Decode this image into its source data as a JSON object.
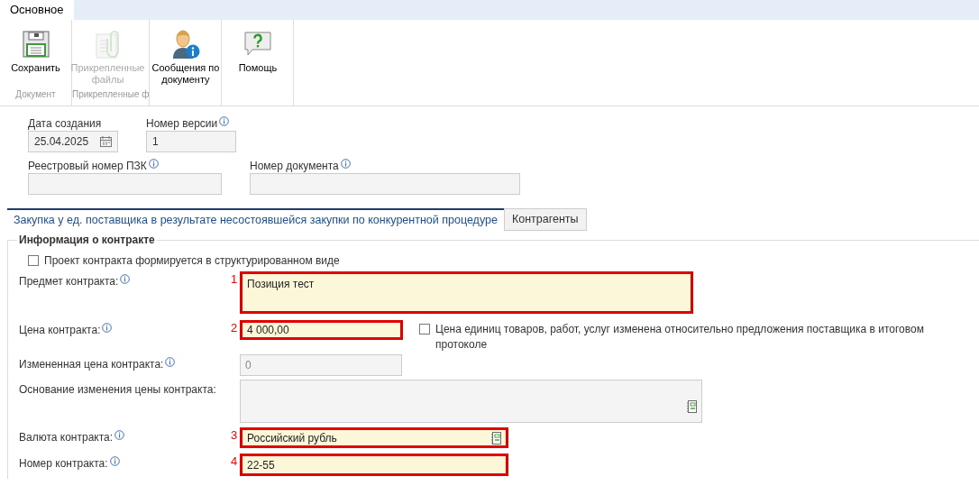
{
  "ribbon": {
    "tabs": [
      {
        "label": "Основное",
        "selected": true
      }
    ],
    "groups": [
      {
        "caption": "Документ",
        "buttons": [
          {
            "label": "Сохранить",
            "disabled": false
          }
        ]
      },
      {
        "caption": "Прикрепленные ф",
        "buttons": [
          {
            "label": "Прикрепленные файлы",
            "disabled": true
          }
        ]
      },
      {
        "buttons": [
          {
            "label": "Сообщения по документу",
            "disabled": false
          }
        ]
      },
      {
        "buttons": [
          {
            "label": "Помощь",
            "disabled": false
          }
        ]
      }
    ]
  },
  "header_fields": [
    [
      {
        "label": "Дата создания",
        "value": "25.04.2025",
        "info": false,
        "kind": "date"
      },
      {
        "label": "Номер версии",
        "value": "1",
        "info": true,
        "kind": "text"
      }
    ],
    [
      {
        "label": "Реестровый номер ПЗК",
        "info": true,
        "kind": "text"
      },
      {
        "label": "Номер документа",
        "info": true,
        "kind": "text"
      }
    ]
  ],
  "doc_tabs": [
    {
      "label": "Закупка у ед. поставщика в результате несостоявшейся закупки по конкурентной процедуре",
      "selected": true
    },
    {
      "label": "Контрагенты",
      "selected": false
    }
  ],
  "section": {
    "title": "Информация о контракте",
    "checkbox": {
      "label": "Проект контракта формируется в структурированном виде",
      "checked": false
    },
    "rows": [
      {
        "kind": "textarea",
        "label": "Предмет контракта:",
        "info": true,
        "marker": "1",
        "value": "Позиция тест",
        "editable": true,
        "highlighted": true
      },
      {
        "kind": "price",
        "label": "Цена контракта:",
        "info": true,
        "marker": "2",
        "value": "4 000,00",
        "editable": true,
        "highlighted": true,
        "checkbox": {
          "label": "Цена единиц товаров, работ, услуг изменена относительно предложения поставщика в итоговом протоколе",
          "checked": false
        }
      },
      {
        "kind": "short",
        "label": "Измененная цена контракта:",
        "info": true,
        "value": "0",
        "editable": false,
        "highlighted": false
      },
      {
        "kind": "memo",
        "label": "Основание изменения цены контракта:",
        "info": false,
        "editable": false,
        "highlighted": false
      },
      {
        "kind": "lookup",
        "label": "Валюта контракта:",
        "info": true,
        "marker": "3",
        "value": "Российский рубль",
        "editable": true,
        "highlighted": true
      },
      {
        "kind": "medium",
        "label": "Номер контракта:",
        "info": true,
        "marker": "4",
        "value": "22-55",
        "editable": true,
        "highlighted": true
      }
    ]
  }
}
